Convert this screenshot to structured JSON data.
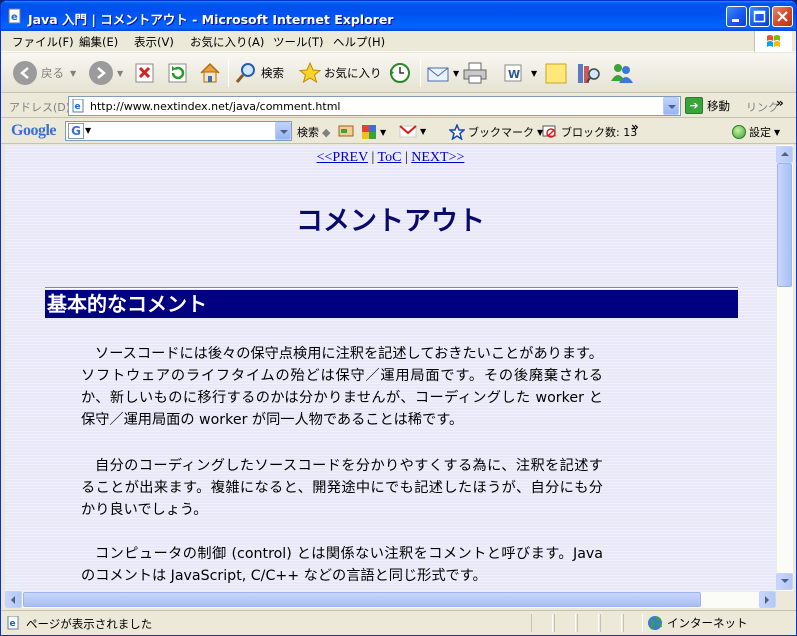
{
  "window": {
    "title": "Java 入門 | コメントアウト - Microsoft Internet Explorer"
  },
  "menu": {
    "file": "ファイル(F)",
    "edit": "編集(E)",
    "view": "表示(V)",
    "favorites": "お気に入り(A)",
    "tools": "ツール(T)",
    "help": "ヘルプ(H)"
  },
  "toolbar": {
    "back_label": "戻る",
    "search_label": "検索",
    "favorites_label": "お気に入り"
  },
  "address": {
    "label": "アドレス(D)",
    "url": "http://www.nextindex.net/java/comment.html",
    "go_label": "移動",
    "links_label": "リンク"
  },
  "google": {
    "logo": "Google",
    "search_label": "検索",
    "bookmarks_label": "ブックマーク",
    "blocked_label": "ブロック数: 13",
    "settings_label": "設定"
  },
  "page": {
    "nav": {
      "prev": "<<PREV",
      "toc": "ToC",
      "next": "NEXT>>",
      "sep": "|"
    },
    "title": "コメントアウト",
    "section_heading": "基本的なコメント",
    "paragraphs": [
      "ソースコードには後々の保守点検用に注釈を記述しておきたいことがあります。ソフトウェアのライフタイムの殆どは保守／運用局面です。その後廃棄されるか、新しいものに移行するのかは分かりませんが、コーディングした worker と保守／運用局面の worker が同一人物であることは稀です。",
      "自分のコーディングしたソースコードを分かりやすくする為に、注釈を記述することが出来ます。複雑になると、開発途中にでも記述したほうが、自分にも分かり良いでしょう。",
      "コンピュータの制御 (control) とは関係ない注釈をコメントと呼びます。Java のコメントは JavaScript, C/C++ などの言語と同じ形式です。"
    ]
  },
  "status": {
    "text": "ページが表示されました",
    "zone": "インターネット"
  },
  "colors": {
    "title_bar": "#0055ea",
    "heading_bg": "#000080",
    "title_text": "#0a0a6a",
    "link": "#0000cc",
    "page_bg": "#e8e8f8"
  }
}
